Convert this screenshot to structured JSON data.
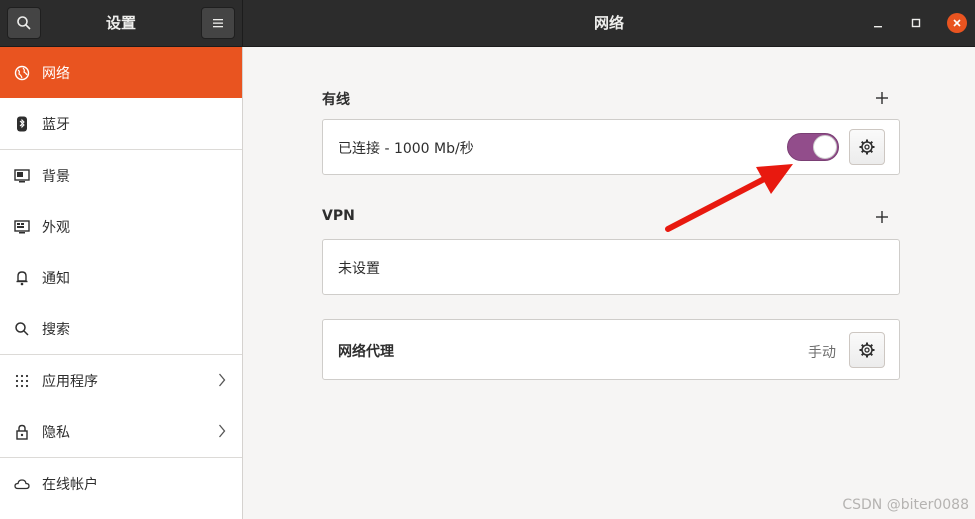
{
  "headerbar": {
    "left_title": "设置",
    "right_title": "网络",
    "search_icon": "search-icon",
    "menu_icon": "hamburger-menu-icon"
  },
  "sidebar": {
    "items": [
      {
        "label": "网络",
        "icon": "globe-icon",
        "active": true
      },
      {
        "label": "蓝牙",
        "icon": "bluetooth-icon"
      },
      {
        "label": "背景",
        "icon": "monitor-icon"
      },
      {
        "label": "外观",
        "icon": "appearance-icon"
      },
      {
        "label": "通知",
        "icon": "bell-icon"
      },
      {
        "label": "搜索",
        "icon": "search-icon"
      },
      {
        "label": "应用程序",
        "icon": "apps-grid-icon",
        "chevron": true
      },
      {
        "label": "隐私",
        "icon": "lock-icon",
        "chevron": true
      },
      {
        "label": "在线帐户",
        "icon": "cloud-icon"
      }
    ]
  },
  "network": {
    "wired": {
      "title": "有线",
      "status": "已连接 - 1000 Mb/秒",
      "toggle_on": true
    },
    "vpn": {
      "title": "VPN",
      "status": "未设置"
    },
    "proxy": {
      "title": "网络代理",
      "mode": "手动"
    }
  },
  "colors": {
    "accent": "#e95420",
    "toggle": "#924d8b",
    "arrow": "#e8190f"
  },
  "watermark": "CSDN @biter0088"
}
